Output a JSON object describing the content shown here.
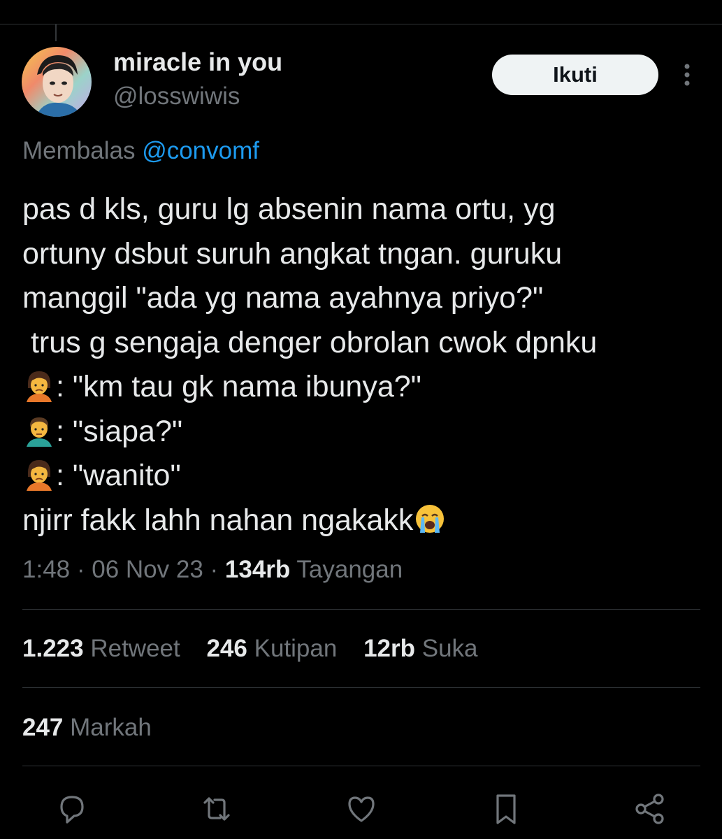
{
  "author": {
    "display_name": "miracle in you",
    "handle": "@losswiwis"
  },
  "follow_button_label": "Ikuti",
  "reply": {
    "prefix": "Membalas",
    "handle": "@convomf"
  },
  "tweet": {
    "lines": [
      "pas d kls, guru lg absenin nama ortu, yg",
      "ortuny dsbut suruh angkat tngan. guruku",
      "manggil \"ada yg nama ayahnya priyo?\"",
      " trus g sengaja denger obrolan cwok dpnku",
      ": \"km tau gk nama ibunya?\"",
      ": \"siapa?\"",
      ": \"wanito\"",
      "njirr fakk lahh nahan ngakakk"
    ],
    "emojis": [
      "person-pouting",
      "man-person",
      "person-pouting",
      "loudly-crying-face"
    ]
  },
  "meta": {
    "time": "1:48",
    "sep": " · ",
    "date": "06 Nov 23",
    "views_count": "134rb",
    "views_label": "Tayangan"
  },
  "stats": {
    "retweets": {
      "count": "1.223",
      "label": "Retweet"
    },
    "quotes": {
      "count": "246",
      "label": "Kutipan"
    },
    "likes": {
      "count": "12rb",
      "label": "Suka"
    },
    "bookmarks": {
      "count": "247",
      "label": "Markah"
    }
  },
  "icons": [
    "more-icon",
    "reply-icon",
    "retweet-icon",
    "like-icon",
    "bookmark-icon",
    "share-icon"
  ],
  "colors": {
    "background": "#000000",
    "text": "#e7e9ea",
    "muted": "#71767b",
    "link": "#1d9bf0",
    "divider": "#2f3336",
    "button_bg": "#eff3f4"
  }
}
